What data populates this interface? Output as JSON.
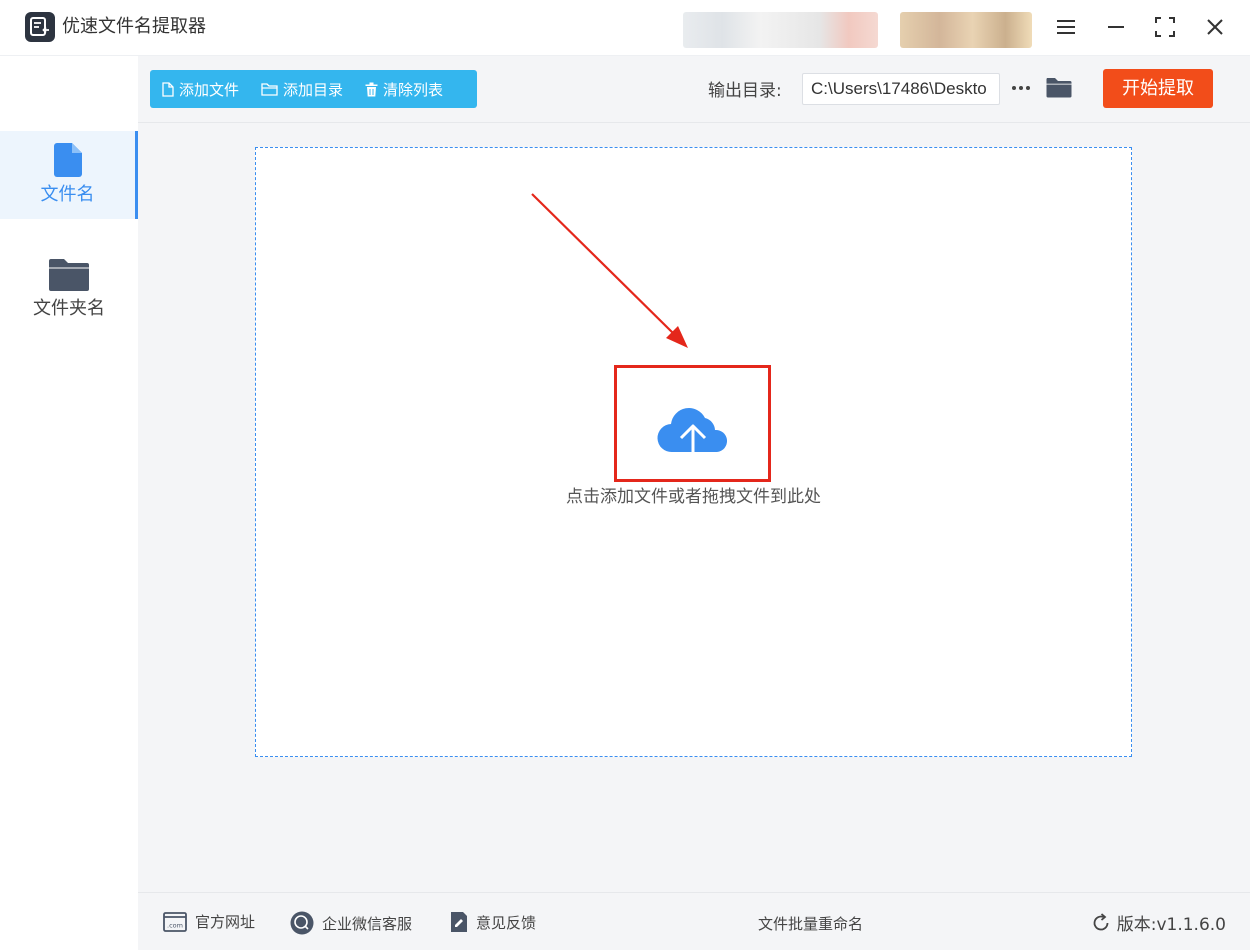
{
  "app": {
    "title": "优速文件名提取器"
  },
  "sidebar": {
    "items": [
      {
        "label": "文件名",
        "icon": "file-icon",
        "active": true
      },
      {
        "label": "文件夹名",
        "icon": "folder-icon",
        "active": false
      }
    ]
  },
  "toolbar": {
    "add_file": "添加文件",
    "add_dir": "添加目录",
    "clear_list": "清除列表",
    "output_label": "输出目录:",
    "output_value": "C:\\Users\\17486\\Deskto",
    "more": "···",
    "start": "开始提取"
  },
  "dropzone": {
    "text": "点击添加文件或者拖拽文件到此处"
  },
  "footer": {
    "website": "官方网址",
    "wechat": "企业微信客服",
    "feedback": "意见反馈",
    "center": "文件批量重命名",
    "version": "版本:v1.1.6.0"
  },
  "colors": {
    "accent": "#34b6ee",
    "primary_blue": "#3a8ef0",
    "start_button": "#f24d1a",
    "highlight_red": "#e4271b"
  }
}
